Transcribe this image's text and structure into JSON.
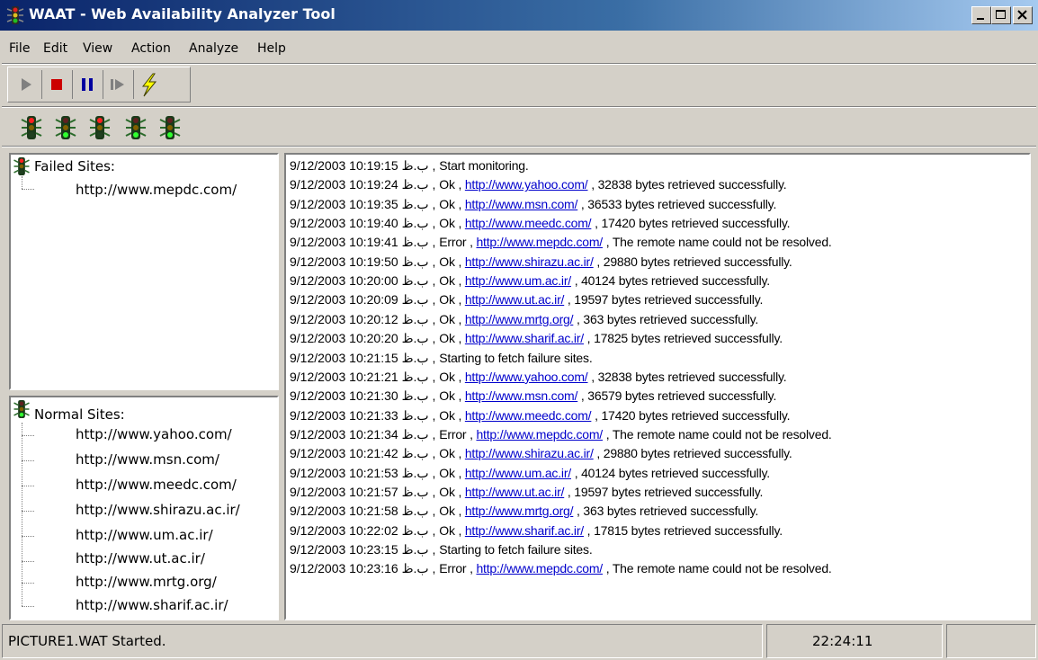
{
  "window": {
    "title": "WAAT - Web Availability Analyzer Tool",
    "icon": "traffic-light-icon",
    "controls": [
      "minimize-icon",
      "maximize-icon",
      "close-icon"
    ]
  },
  "menu": [
    "File",
    "Edit",
    "View",
    "Action",
    "Analyze",
    "Help"
  ],
  "toolbar": {
    "buttons": [
      {
        "name": "play-button",
        "icon": "play-icon",
        "color": "#808080"
      },
      {
        "name": "stop-button",
        "icon": "stop-icon",
        "color": "#cc0000"
      },
      {
        "name": "pause-button",
        "icon": "pause-icon",
        "color": "#0000a0"
      },
      {
        "name": "step-button",
        "icon": "step-icon",
        "color": "#808080"
      },
      {
        "name": "analyze-button",
        "icon": "lightning-icon",
        "color": "#ffff00"
      }
    ]
  },
  "traffic_lights": [
    {
      "name": "traffic-light-1",
      "state": "red"
    },
    {
      "name": "traffic-light-2",
      "state": "green"
    },
    {
      "name": "traffic-light-3",
      "state": "red"
    },
    {
      "name": "traffic-light-4",
      "state": "green"
    },
    {
      "name": "traffic-light-5",
      "state": "green"
    }
  ],
  "failed_sites": {
    "title": "Failed Sites:",
    "items": [
      "http://www.mepdc.com/"
    ]
  },
  "normal_sites": {
    "title": "Normal Sites:",
    "items": [
      "http://www.yahoo.com/",
      "http://www.msn.com/",
      "http://www.meedc.com/",
      "http://www.shirazu.ac.ir/",
      "http://www.um.ac.ir/",
      "http://www.ut.ac.ir/",
      "http://www.mrtg.org/",
      "http://www.sharif.ac.ir/"
    ]
  },
  "log": [
    {
      "ts": "9/12/2003 10:19:15 ب.ظ",
      "status": "Start monitoring.",
      "url": "",
      "msg": ""
    },
    {
      "ts": "9/12/2003 10:19:24 ب.ظ",
      "status": "Ok",
      "url": "http://www.yahoo.com/",
      "msg": "32838 bytes retrieved successfully."
    },
    {
      "ts": "9/12/2003 10:19:35 ب.ظ",
      "status": "Ok",
      "url": "http://www.msn.com/",
      "msg": "36533 bytes retrieved successfully."
    },
    {
      "ts": "9/12/2003 10:19:40 ب.ظ",
      "status": "Ok",
      "url": "http://www.meedc.com/",
      "msg": "17420 bytes retrieved successfully."
    },
    {
      "ts": "9/12/2003 10:19:41 ب.ظ",
      "status": "Error",
      "url": "http://www.mepdc.com/",
      "msg": "The remote name could not be resolved."
    },
    {
      "ts": "9/12/2003 10:19:50 ب.ظ",
      "status": "Ok",
      "url": "http://www.shirazu.ac.ir/",
      "msg": "29880 bytes retrieved successfully."
    },
    {
      "ts": "9/12/2003 10:20:00 ب.ظ",
      "status": "Ok",
      "url": "http://www.um.ac.ir/",
      "msg": "40124 bytes retrieved successfully."
    },
    {
      "ts": "9/12/2003 10:20:09 ب.ظ",
      "status": "Ok",
      "url": "http://www.ut.ac.ir/",
      "msg": "19597 bytes retrieved successfully."
    },
    {
      "ts": "9/12/2003 10:20:12 ب.ظ",
      "status": "Ok",
      "url": "http://www.mrtg.org/",
      "msg": "363 bytes retrieved successfully."
    },
    {
      "ts": "9/12/2003 10:20:20 ب.ظ",
      "status": "Ok",
      "url": "http://www.sharif.ac.ir/",
      "msg": "17825 bytes retrieved successfully."
    },
    {
      "ts": "9/12/2003 10:21:15 ب.ظ",
      "status": "Starting to fetch failure sites.",
      "url": "",
      "msg": ""
    },
    {
      "ts": "9/12/2003 10:21:21 ب.ظ",
      "status": "Ok",
      "url": "http://www.yahoo.com/",
      "msg": "32838 bytes retrieved successfully."
    },
    {
      "ts": "9/12/2003 10:21:30 ب.ظ",
      "status": "Ok",
      "url": "http://www.msn.com/",
      "msg": "36579 bytes retrieved successfully."
    },
    {
      "ts": "9/12/2003 10:21:33 ب.ظ",
      "status": "Ok",
      "url": "http://www.meedc.com/",
      "msg": "17420 bytes retrieved successfully."
    },
    {
      "ts": "9/12/2003 10:21:34 ب.ظ",
      "status": "Error",
      "url": "http://www.mepdc.com/",
      "msg": "The remote name could not be resolved."
    },
    {
      "ts": "9/12/2003 10:21:42 ب.ظ",
      "status": "Ok",
      "url": "http://www.shirazu.ac.ir/",
      "msg": "29880 bytes retrieved successfully."
    },
    {
      "ts": "9/12/2003 10:21:53 ب.ظ",
      "status": "Ok",
      "url": "http://www.um.ac.ir/",
      "msg": "40124 bytes retrieved successfully."
    },
    {
      "ts": "9/12/2003 10:21:57 ب.ظ",
      "status": "Ok",
      "url": "http://www.ut.ac.ir/",
      "msg": "19597 bytes retrieved successfully."
    },
    {
      "ts": "9/12/2003 10:21:58 ب.ظ",
      "status": "Ok",
      "url": "http://www.mrtg.org/",
      "msg": "363 bytes retrieved successfully."
    },
    {
      "ts": "9/12/2003 10:22:02 ب.ظ",
      "status": "Ok",
      "url": "http://www.sharif.ac.ir/",
      "msg": "17815 bytes retrieved successfully."
    },
    {
      "ts": "9/12/2003 10:23:15 ب.ظ",
      "status": "Starting to fetch failure sites.",
      "url": "",
      "msg": ""
    },
    {
      "ts": "9/12/2003 10:23:16 ب.ظ",
      "status": "Error",
      "url": "http://www.mepdc.com/",
      "msg": "The remote name could not be resolved."
    }
  ],
  "status_bar": {
    "message": "PICTURE1.WAT Started.",
    "time": "22:24:11"
  },
  "colors": {
    "titlebar_start": "#0a246a",
    "titlebar_end": "#a6caf0",
    "link": "#0000cc",
    "face": "#d4d0c8"
  }
}
